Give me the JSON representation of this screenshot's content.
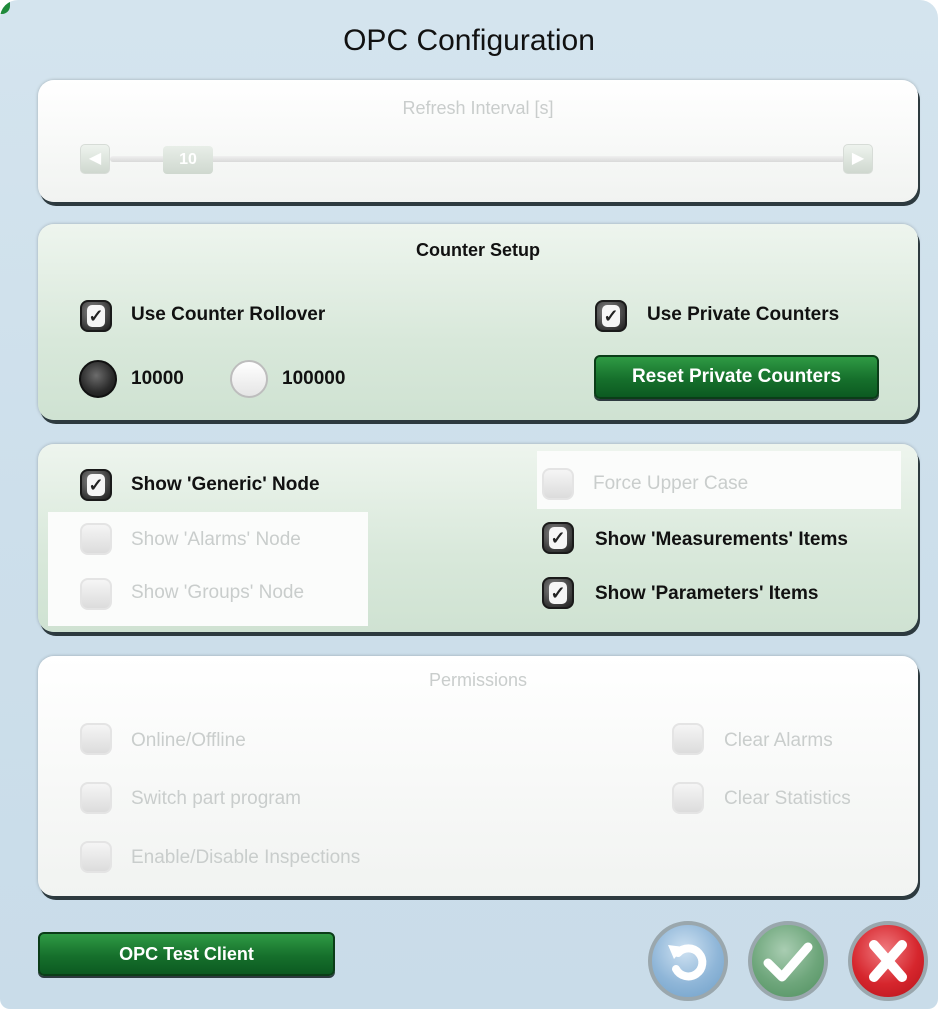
{
  "window": {
    "title": "OPC Configuration"
  },
  "refresh": {
    "title": "Refresh Interval [s]",
    "value": "10",
    "level_fraction": 0.05
  },
  "counter": {
    "title": "Counter Setup",
    "use_rollover": {
      "label": "Use Counter Rollover",
      "checked": true
    },
    "use_private": {
      "label": "Use Private Counters",
      "checked": true
    },
    "radio_10000": {
      "label": "10000",
      "selected": true
    },
    "radio_100000": {
      "label": "100000",
      "selected": false
    },
    "reset_button": "Reset Private Counters"
  },
  "nodes": {
    "show_generic": {
      "label": "Show 'Generic' Node",
      "checked": true
    },
    "show_alarms": {
      "label": "Show 'Alarms' Node",
      "checked": false,
      "enabled": false
    },
    "show_groups": {
      "label": "Show 'Groups' Node",
      "checked": false,
      "enabled": false
    },
    "force_upper": {
      "label": "Force Upper Case",
      "checked": false,
      "enabled": false
    },
    "show_measurements": {
      "label": "Show 'Measurements' Items",
      "checked": true
    },
    "show_parameters": {
      "label": "Show 'Parameters' Items",
      "checked": true
    }
  },
  "permissions": {
    "title": "Permissions",
    "online_offline": "Online/Offline",
    "switch_part": "Switch part program",
    "enable_disable": "Enable/Disable Inspections",
    "clear_alarms": "Clear Alarms",
    "clear_statistics": "Clear Statistics"
  },
  "footer": {
    "test_client_button": "OPC Test Client"
  },
  "colors": {
    "accent_green": "#16702c",
    "cancel_red": "#c0141c",
    "ok_green": "#4f8f5e",
    "undo_blue": "#6e9fc8"
  },
  "icons": {
    "undo": "undo-arrow-icon",
    "ok": "checkmark-icon",
    "cancel": "close-x-icon"
  }
}
